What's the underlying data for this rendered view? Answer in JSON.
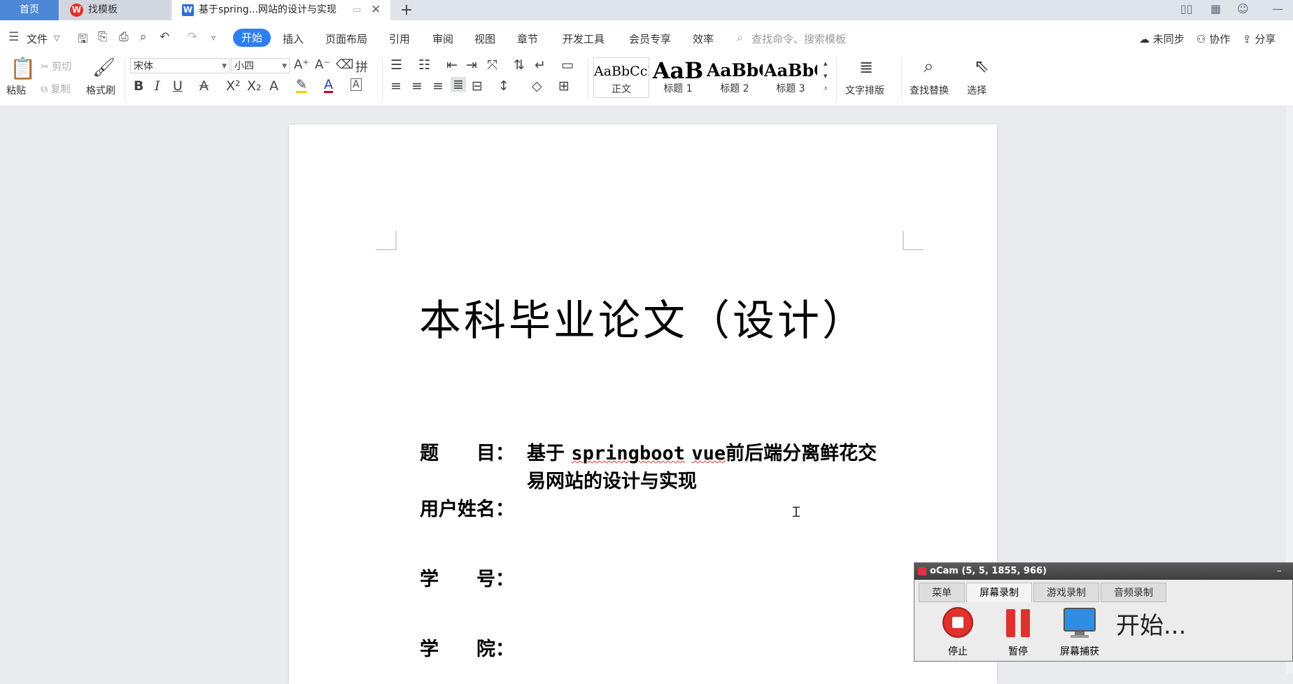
{
  "tabs": {
    "home": "首页",
    "template": "找模板",
    "document": "基于spring...网站的设计与实现",
    "add": "+"
  },
  "menu": {
    "file": "文件",
    "items": [
      "开始",
      "插入",
      "页面布局",
      "引用",
      "审阅",
      "视图",
      "章节",
      "开发工具",
      "会员专享",
      "效率"
    ],
    "search_placeholder": "查找命令、搜索模板",
    "sync": "未同步",
    "collab": "协作",
    "share": "分享"
  },
  "ribbon": {
    "paste": "粘贴",
    "cut": "剪切",
    "copy": "复制",
    "format_painter": "格式刷",
    "font_name": "宋体",
    "font_size": "小四",
    "styles": [
      {
        "sample": "AaBbCcI",
        "label": "正文"
      },
      {
        "sample": "AaB",
        "label": "标题 1"
      },
      {
        "sample": "AaBbC",
        "label": "标题 2"
      },
      {
        "sample": "AaBbC",
        "label": "标题 3"
      }
    ],
    "text_layout": "文字排版",
    "find_replace": "查找替换",
    "select": "选择"
  },
  "document": {
    "title": "本科毕业论文（设计）",
    "fields": {
      "topic_label": "题　　目：",
      "topic_prefix": "基于",
      "topic_word1": "springboot",
      "topic_word2": "vue",
      "topic_line1_rest": "前后端分离鲜花交",
      "topic_line2": "易网站的设计与实现",
      "user_label": "用户姓名：",
      "id_label": "学　　号：",
      "college_label": "学　　院："
    }
  },
  "ocam": {
    "title": "oCam (5, 5, 1855, 966)",
    "tabs": [
      "菜单",
      "屏幕录制",
      "游戏录制",
      "音频录制"
    ],
    "buttons": [
      "停止",
      "暂停",
      "屏幕捕获"
    ],
    "status": "开始..."
  },
  "colors": {
    "accent": "#2d7ff0",
    "home_tab": "#4d88d6",
    "stop_red": "#e0312c"
  }
}
